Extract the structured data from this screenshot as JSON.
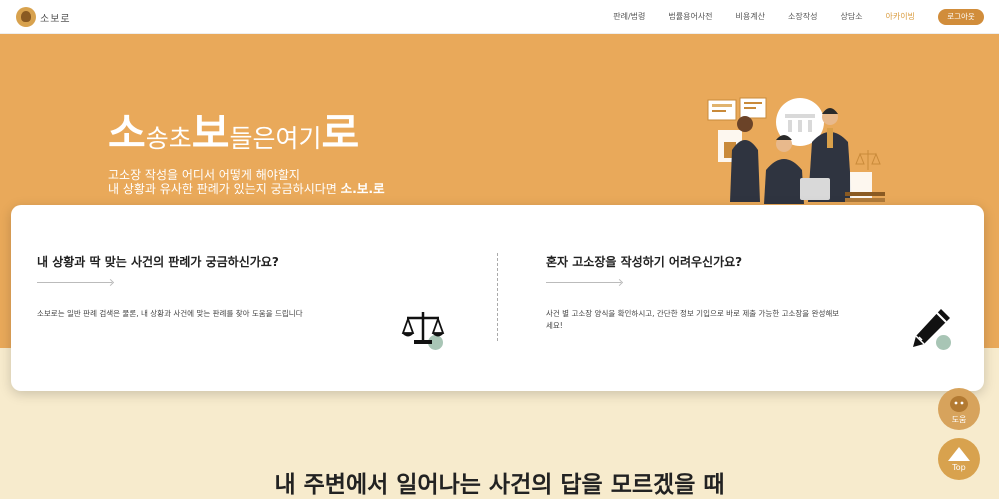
{
  "header": {
    "logo_text": "소보로",
    "nav": [
      "판례/법령",
      "법률용어사전",
      "비용계산",
      "소장작성",
      "상담소",
      "아카이빙"
    ],
    "login_label": "로그아웃"
  },
  "hero": {
    "title_parts": [
      {
        "text": "소",
        "size": "big"
      },
      {
        "text": "송초",
        "size": "small"
      },
      {
        "text": "보",
        "size": "big"
      },
      {
        "text": "들은여기",
        "size": "small"
      },
      {
        "text": "로",
        "size": "big"
      }
    ],
    "desc_line1": "고소장 작성을 어디서 어떻게 해야할지",
    "desc_line2": "내 상황과 유사한 판례가 있는지 궁금하시다면",
    "desc_accent": "소.보.로"
  },
  "cards": [
    {
      "title": "내 상황과 딱 맞는 사건의 판례가 궁금하신가요?",
      "desc": "소보로는 일반 판례 검색은 물론, 내 상황과 사건에 맞는 판례를 찾아 도움을 드립니다",
      "icon": "scale-icon"
    },
    {
      "title": "혼자 고소장을 작성하기 어려우신가요?",
      "desc": "사건 별 고소장 양식을 확인하시고, 간단한 정보 기입으로 바로 제출 가능한 고소장을 완성해보세요!",
      "icon": "pencil-icon"
    }
  ],
  "bottom_title": "내 주변에서 일어나는 사건의 답을 모르겠을 때",
  "fab": {
    "help_label": "도움",
    "top_label": "Top"
  },
  "colors": {
    "hero_bg": "#e9a95a",
    "accent": "#d18d3b",
    "page_bg": "#f7ebcd",
    "icon_dot": "#a8c5b5"
  }
}
